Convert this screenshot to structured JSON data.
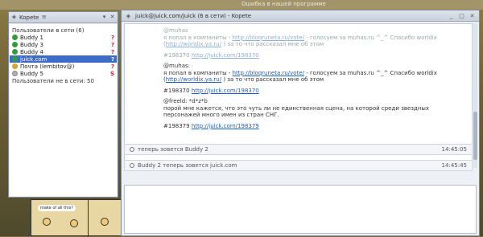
{
  "desktop": {
    "topbar_text": "Ошибка в нашей программе"
  },
  "comic": {
    "bubble_text": "make of all this?"
  },
  "contact_list": {
    "title": "Kopete",
    "online_group": "Пользователи в сети (6)",
    "contacts": [
      {
        "name": "Buddy 1",
        "status": "on",
        "mark": "?"
      },
      {
        "name": "Buddy 3",
        "status": "on",
        "mark": "?"
      },
      {
        "name": "Buddy 4",
        "status": "on",
        "mark": "?"
      },
      {
        "name": "juick.com",
        "status": "on",
        "mark": "?",
        "selected": true
      },
      {
        "name": "Почта (lembitov@)",
        "status": "away",
        "mark": "?"
      },
      {
        "name": "Buddy 5",
        "status": "off",
        "mark": "S"
      }
    ],
    "offline_group": "Пользователи не в сети: 50"
  },
  "chat": {
    "title": "juick@juick.com/juick (6 в сети) - Kopete",
    "messages": {
      "m1_user": "@muhas",
      "m1_text_a": "я попал в компаниты - ",
      "m1_link": "http://bloqruneta.ru/vote/",
      "m1_text_b": " - голосуем за muhas.ru ^_^ Спасибо worldix (",
      "m1_link2": "http://worldix.ya.ru/",
      "m1_text_c": " ) за то что рассказал мне об этом",
      "m1_num": "#198370",
      "m1_numlink": "http://juick.com/198370",
      "m2_user": "@muhas:",
      "m2_text_a": "я попал в компаниты - ",
      "m2_link": "http://bloqruneta.ru/vote/",
      "m2_text_b": " - голосуем за muhas.ru ^_^ Спасибо worldix (",
      "m2_link2": "http://worldix.ya.ru/",
      "m2_text_c": " ) за то что рассказал мне об этом",
      "m2_num": "#198370",
      "m2_numlink": "http://juick.com/198370",
      "m3_user": "@freeld: *d*z*b",
      "m3_text": "порой мне кажется, что это чуть ли не единственная сцена, на которой среди звездных персонажей много имен из стран СНГ.",
      "m3_num": "#198379",
      "m3_numlink": "http://juick.com/198379"
    },
    "sys1_text": "теперь зовется Buddy 2",
    "sys1_time": "14:45:05",
    "sys2_text": "Buddy 2 теперь зовется juick.com",
    "sys2_time": "14:45:45"
  }
}
